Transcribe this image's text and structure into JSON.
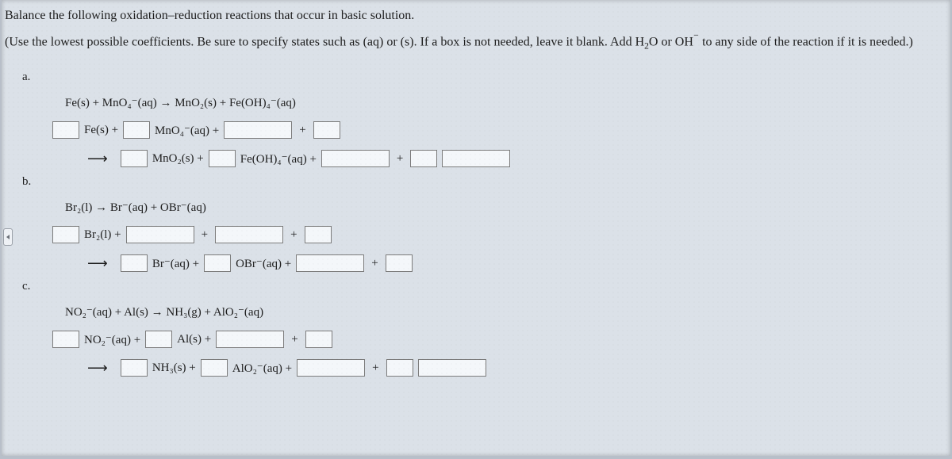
{
  "intro": {
    "line1": "Balance the following oxidation–reduction reactions that occur in basic solution.",
    "line2_pre": "(Use the lowest possible coefficients. Be sure to specify states such as (aq) or (s). If a box is not needed, leave it blank. Add H",
    "line2_h2o_sub": "2",
    "line2_post_h2o": "O or OH",
    "line2_tail": " to any side of the reaction if it is needed.)"
  },
  "parts": {
    "a": {
      "label": "a.",
      "eq_html": "Fe(s) + MnO₄⁻(aq) → MnO₂(s) + Fe(OH)₄⁻(aq)",
      "r1": {
        "t1": "Fe(s)  +",
        "t2": "MnO₄⁻(aq)  +"
      },
      "r2": {
        "t1": "MnO₂(s)  +",
        "t2": "Fe(OH)₄⁻(aq)  +"
      }
    },
    "b": {
      "label": "b.",
      "eq_html": "Br₂(l) → Br⁻(aq) + OBr⁻(aq)",
      "r1": {
        "t1": "Br₂(l)  +"
      },
      "r2": {
        "t1": "Br⁻(aq)  +",
        "t2": "OBr⁻(aq)  +"
      }
    },
    "c": {
      "label": "c.",
      "eq_html": "NO₂⁻(aq) + Al(s) → NH₃(g) + AlO₂⁻(aq)",
      "r1": {
        "t1": "NO₂⁻(aq)  +",
        "t2": "Al(s)  +"
      },
      "r2": {
        "t1": "NH₃(s)  +",
        "t2": "AlO₂⁻(aq)  +"
      }
    }
  },
  "glyph": {
    "plus": "+",
    "arrow": "⟶",
    "neg": "⁻"
  }
}
